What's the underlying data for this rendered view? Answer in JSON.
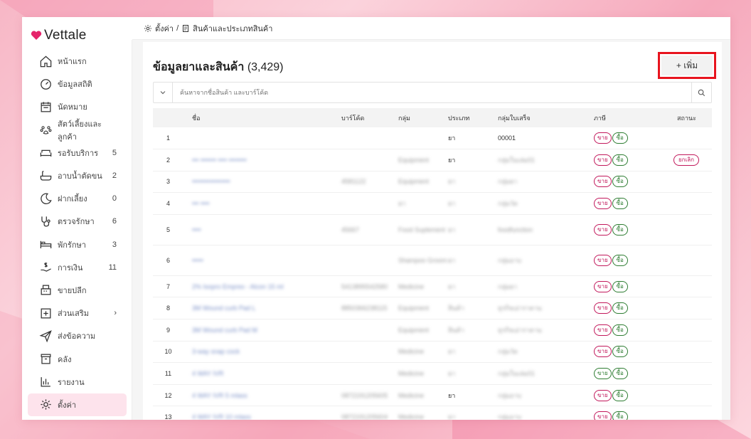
{
  "app": {
    "name": "Vettale",
    "brand_color": "#e5246b"
  },
  "breadcrumb": {
    "root": "ตั้งค่า",
    "separator": "/",
    "current": "สินค้าและประเภทสินค้า"
  },
  "sidebar": {
    "items": [
      {
        "icon": "home-icon",
        "label": "หน้าแรก",
        "count": ""
      },
      {
        "icon": "dashboard-icon",
        "label": "ข้อมูลสถิติ",
        "count": ""
      },
      {
        "icon": "calendar-icon",
        "label": "นัดหมาย",
        "count": ""
      },
      {
        "icon": "paw-icon",
        "label": "สัตว์เลี้ยงและลูกค้า",
        "count": ""
      },
      {
        "icon": "sofa-icon",
        "label": "รอรับบริการ",
        "count": "5"
      },
      {
        "icon": "bathtub-icon",
        "label": "อาบน้ำตัดขน",
        "count": "2"
      },
      {
        "icon": "moon-icon",
        "label": "ฝากเลี้ยง",
        "count": "0"
      },
      {
        "icon": "stethoscope-icon",
        "label": "ตรวจรักษา",
        "count": "6"
      },
      {
        "icon": "bed-icon",
        "label": "พักรักษา",
        "count": "3"
      },
      {
        "icon": "money-hand-icon",
        "label": "การเงิน",
        "count": "11"
      },
      {
        "icon": "cash-register-icon",
        "label": "ขายปลีก",
        "count": ""
      },
      {
        "icon": "plus-box-icon",
        "label": "ส่วนเสริม",
        "count": "›"
      },
      {
        "icon": "send-icon",
        "label": "ส่งข้อความ",
        "count": ""
      },
      {
        "icon": "archive-icon",
        "label": "คลัง",
        "count": ""
      },
      {
        "icon": "bar-chart-icon",
        "label": "รายงาน",
        "count": ""
      },
      {
        "icon": "gear-icon",
        "label": "ตั้งค่า",
        "count": ""
      }
    ],
    "active_index": 15
  },
  "page": {
    "title": "ข้อมูลยาและสินค้า",
    "count": "(3,429)",
    "add_button": "+ เพิ่ม",
    "search_placeholder": "ค้นหาจากชื่อสินค้า และบาร์โค้ด"
  },
  "table": {
    "headers": [
      "",
      "ชื่อ",
      "บาร์โค้ด",
      "กลุ่ม",
      "ประเภท",
      "กลุ่มใบเสร็จ",
      "ภาษี",
      "สถานะ"
    ],
    "pill_sell": "ขาย",
    "pill_buy": "ซื้อ",
    "pill_cancel": "ยกเลิก",
    "rows": [
      {
        "no": "1",
        "name": "",
        "barcode": "",
        "group": "",
        "type": "ยา",
        "receipt": "00001",
        "sell_color": "sell",
        "status": "",
        "tall": false,
        "blur": false
      },
      {
        "no": "2",
        "name": "••• ••••••• •••• ••••••••",
        "barcode": "",
        "group": "Equipment",
        "type": "ยา",
        "receipt": "กลุ่มในเล่ม01",
        "sell_color": "sell",
        "status": "cancel",
        "tall": false,
        "blur": true
      },
      {
        "no": "3",
        "name": "•••••••••••••••••",
        "barcode": "4581122",
        "group": "Equipment",
        "type": "ยา",
        "receipt": "กลุ่มยา",
        "sell_color": "sell",
        "status": "",
        "tall": false,
        "blur": true
      },
      {
        "no": "4",
        "name": "••• ••••",
        "barcode": "",
        "group": "ยา",
        "type": "ยา",
        "receipt": "กลุ่มวัด",
        "sell_color": "sell",
        "status": "",
        "tall": false,
        "blur": true
      },
      {
        "no": "5",
        "name": "••••",
        "barcode": "45667",
        "group": "Food Suplement",
        "type": "ยา",
        "receipt": "foodfunction",
        "sell_color": "sell",
        "status": "",
        "tall": true,
        "blur": true
      },
      {
        "no": "6",
        "name": "•••••",
        "barcode": "",
        "group": "Shampoo Groom",
        "type": "ยา",
        "receipt": "กลุ่มอาบ",
        "sell_color": "sell",
        "status": "",
        "tall": true,
        "blur": true
      },
      {
        "no": "7",
        "name": "2% Isopro Emprex - Alcon 15 ml",
        "barcode": "5413895542580",
        "group": "Medicine",
        "type": "ยา",
        "receipt": "กลุ่มยา",
        "sell_color": "sell",
        "status": "",
        "tall": false,
        "blur": true
      },
      {
        "no": "8",
        "name": "3M Wound curb Pad L",
        "barcode": "8850366238115",
        "group": "Equipment",
        "type": "สินค้า",
        "receipt": "ธุรกิจเอ่าราคาน",
        "sell_color": "sell",
        "status": "",
        "tall": false,
        "blur": true
      },
      {
        "no": "9",
        "name": "3M Wound curb Pad M",
        "barcode": "",
        "group": "Equipment",
        "type": "สินค้า",
        "receipt": "ธุรกิจเอ่าราคาน",
        "sell_color": "sell",
        "status": "",
        "tall": false,
        "blur": true
      },
      {
        "no": "10",
        "name": "3-way snap cock",
        "barcode": "",
        "group": "Medicine",
        "type": "ยา",
        "receipt": "กลุ่มวัด",
        "sell_color": "sell",
        "status": "",
        "tall": false,
        "blur": true
      },
      {
        "no": "11",
        "name": "4 WAY IVR",
        "barcode": "",
        "group": "Medicine",
        "type": "ยา",
        "receipt": "กลุ่มในเล่ม01",
        "sell_color": "buy",
        "status": "",
        "tall": false,
        "blur": true
      },
      {
        "no": "12",
        "name": "4 WAY IVR 5 mlass",
        "barcode": "0872191205605",
        "group": "Medicine",
        "type": "ยา",
        "receipt": "กลุ่มอาบ",
        "sell_color": "sell",
        "status": "",
        "tall": false,
        "blur": true
      },
      {
        "no": "13",
        "name": "4 WAY IVR 10 mlass",
        "barcode": "0872191205604",
        "group": "Medicine",
        "type": "ยา",
        "receipt": "กลุ่มอาบ",
        "sell_color": "sell",
        "status": "",
        "tall": false,
        "blur": true
      }
    ]
  }
}
